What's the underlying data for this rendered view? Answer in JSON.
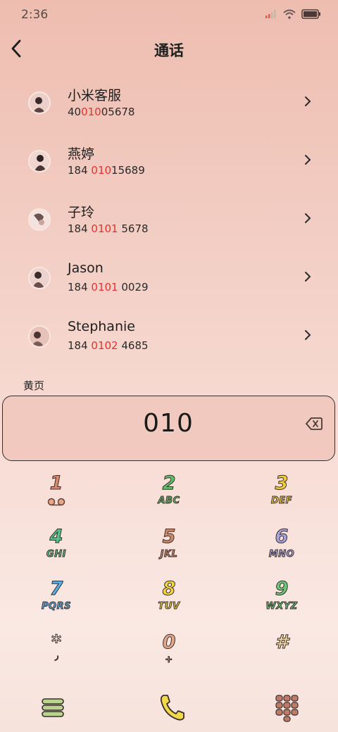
{
  "status_bar": {
    "time": "2:36"
  },
  "header": {
    "title": "通话"
  },
  "contacts": [
    {
      "name": "小米客服",
      "number_parts": [
        "40",
        "010",
        "05678"
      ]
    },
    {
      "name": "燕婷",
      "number_parts": [
        "184 ",
        "010",
        "15689"
      ]
    },
    {
      "name": "子玲",
      "number_parts": [
        "184 ",
        "0101",
        " 5678"
      ]
    },
    {
      "name": "Jason",
      "number_parts": [
        "184 ",
        "0101",
        " 0029"
      ]
    },
    {
      "name": "Stephanie",
      "number_parts": [
        "184 ",
        "0102",
        " 4685"
      ]
    }
  ],
  "yellow_pages_label": "黄页",
  "dial": {
    "number": "010"
  },
  "keypad": [
    {
      "digit": "1",
      "letters": "",
      "color": "#d98a6e"
    },
    {
      "digit": "2",
      "letters": "ABC",
      "color": "#5fbf6a"
    },
    {
      "digit": "3",
      "letters": "DEF",
      "color": "#f2cf3a"
    },
    {
      "digit": "4",
      "letters": "GHI",
      "color": "#58c08a"
    },
    {
      "digit": "5",
      "letters": "JKL",
      "color": "#d08a6a"
    },
    {
      "digit": "6",
      "letters": "MNO",
      "color": "#a8a2dc"
    },
    {
      "digit": "7",
      "letters": "PQRS",
      "color": "#5aaee6"
    },
    {
      "digit": "8",
      "letters": "TUV",
      "color": "#f2d43c"
    },
    {
      "digit": "9",
      "letters": "WXYZ",
      "color": "#6bc77a"
    },
    {
      "digit": "*",
      "letters": "",
      "color": "#f7e8e2"
    },
    {
      "digit": "0",
      "letters": "+",
      "color": "#e3a78a"
    },
    {
      "digit": "#",
      "letters": "",
      "color": "#f3d9a2"
    }
  ],
  "colors": {
    "highlight": "#e6312e",
    "menu_green": "#b9d48f",
    "call_yellow": "#f2d94a",
    "keypad_brown": "#c07a65"
  }
}
